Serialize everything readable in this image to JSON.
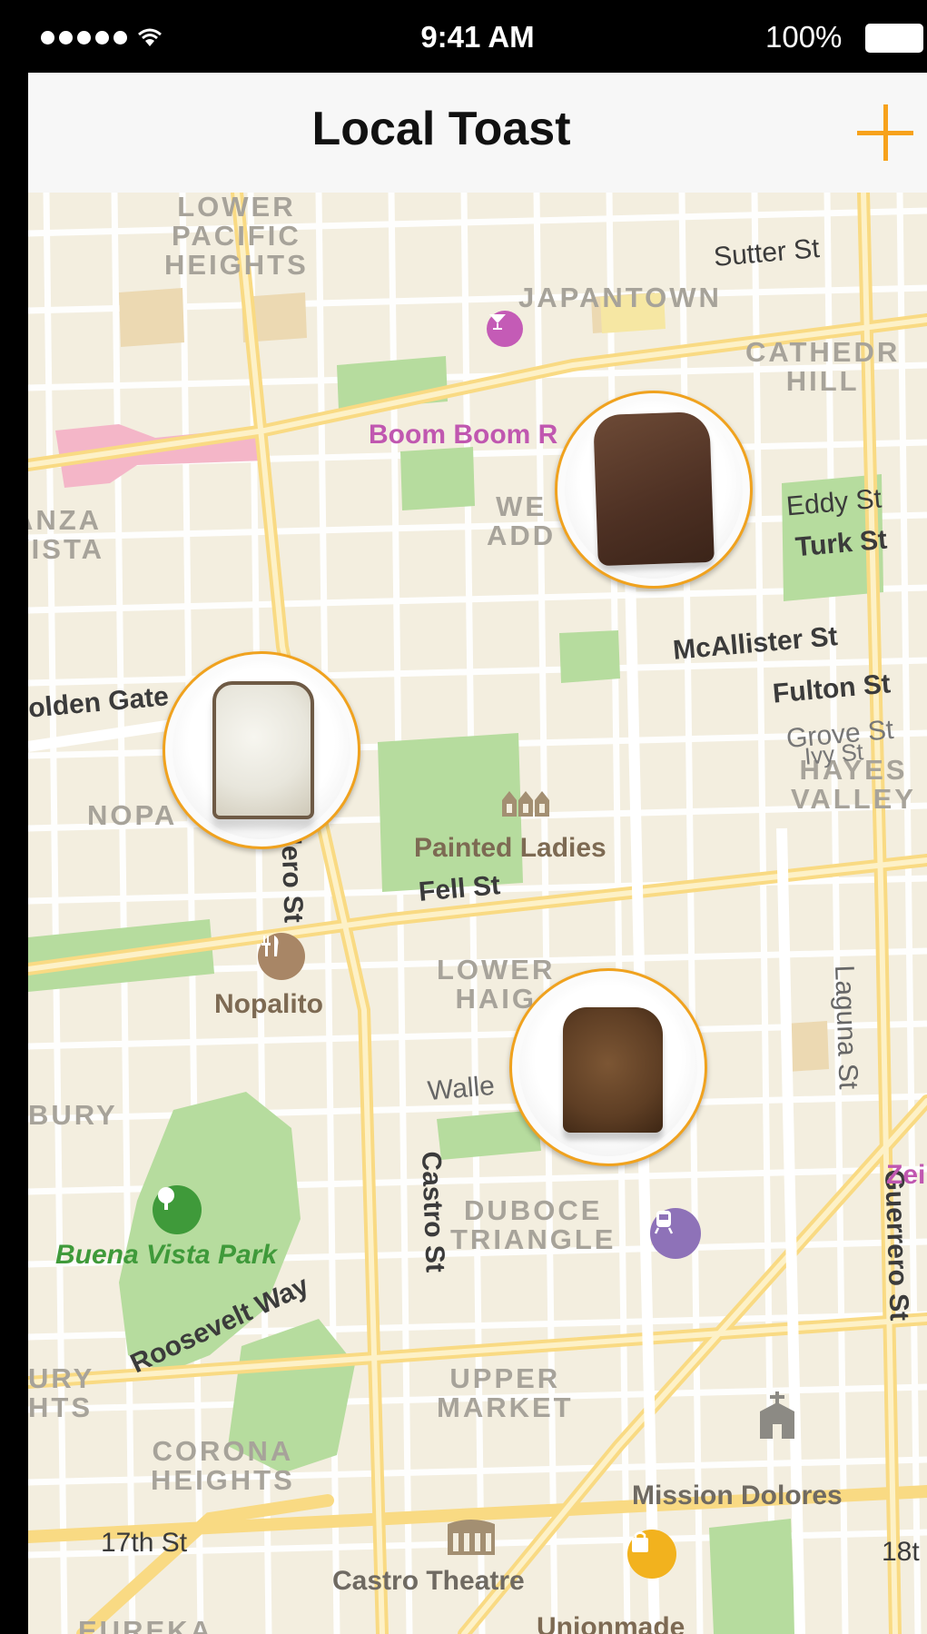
{
  "status_bar": {
    "time": "9:41 AM",
    "battery": "100%",
    "signal_icon": "signal-dots-icon",
    "wifi_icon": "wifi-icon",
    "battery_icon": "battery-icon"
  },
  "nav": {
    "title": "Local Toast",
    "add_icon": "plus-icon",
    "accent": "#f7a21b"
  },
  "map": {
    "areas": {
      "lower_pacific_heights": "LOWER\nPACIFIC\nHEIGHTS",
      "japantown": "JAPANTOWN",
      "cathedral_hill": "CATHEDR\nHILL",
      "anza_vista": "ANZA\nVISTA",
      "western_addition": "WE\nADD",
      "nopa": "NOPA",
      "hayes_valley": "HAYES\nVALLEY",
      "lower_haight": "LOWER\nHAIG",
      "duboce_triangle": "DUBOCE\nTRIANGLE",
      "upper_market": "UPPER\nMARKET",
      "corona_heights": "CORONA\nHEIGHTS",
      "ashbury": "BURY",
      "ashbury_heights": "URY\nHTS",
      "eureka": "EUREKA"
    },
    "streets": {
      "sutter": "Sutter St",
      "eddy": "Eddy St",
      "turk": "Turk St",
      "mcallister": "McAllister St",
      "fulton": "Fulton St",
      "grove": "Grove St",
      "ivy": "Ivy St",
      "golden_gate": "olden Gate",
      "fell": "Fell St",
      "divisadero": "dero St",
      "laguna": "Laguna St",
      "waller": "Walle",
      "castro": "Castro St",
      "guerrero": "Guerrero St",
      "roosevelt": "Roosevelt Way",
      "seventeenth": "17th St",
      "eighteenth": "18t"
    },
    "pois": {
      "boom_boom": "Boom Boom R",
      "painted_ladies": "Painted Ladies",
      "nopalito": "Nopalito",
      "buena_vista": "Buena Vista Park",
      "mission_dolores": "Mission Dolores",
      "castro_theatre": "Castro Theatre",
      "unionmade": "Unionmade",
      "zeitgeist": "Zei"
    },
    "poi_icons": [
      "cocktail-icon",
      "landmark-icon",
      "restaurant-icon",
      "tree-icon",
      "train-icon",
      "church-icon",
      "theatre-icon",
      "shopping-bag-icon"
    ],
    "colors": {
      "land": "#f3eedf",
      "road": "#ffffff",
      "arterial": "#fbe08e",
      "park": "#b6dc9e",
      "pink": "#f4b6c8",
      "accent": "#f7a21b"
    }
  },
  "toast_pins": [
    {
      "name": "chocolate-spread-toast",
      "toast_color": "#5a3a2a"
    },
    {
      "name": "ricotta-pepper-toast",
      "toast_color": "#efeee6"
    },
    {
      "name": "cinnamon-raisin-toast",
      "toast_color": "#6b4a2c"
    }
  ]
}
